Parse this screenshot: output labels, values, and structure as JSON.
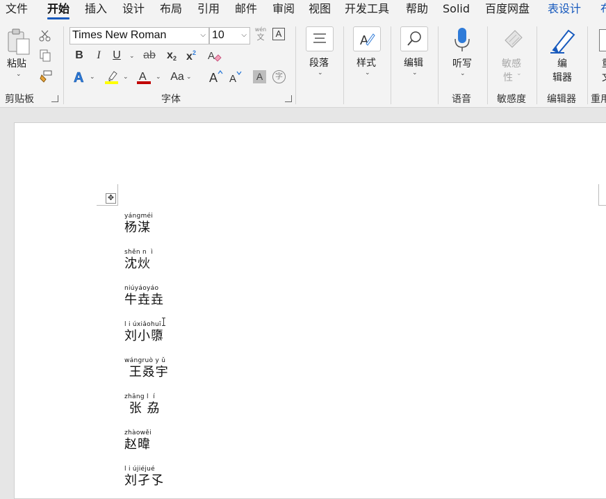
{
  "tabs": [
    {
      "label": "文件",
      "state": "normal"
    },
    {
      "label": "开始",
      "state": "active"
    },
    {
      "label": "插入",
      "state": "normal"
    },
    {
      "label": "设计",
      "state": "normal"
    },
    {
      "label": "布局",
      "state": "normal"
    },
    {
      "label": "引用",
      "state": "normal"
    },
    {
      "label": "邮件",
      "state": "normal"
    },
    {
      "label": "审阅",
      "state": "normal"
    },
    {
      "label": "视图",
      "state": "normal"
    },
    {
      "label": "开发工具",
      "state": "normal"
    },
    {
      "label": "帮助",
      "state": "normal"
    },
    {
      "label": "Solid",
      "state": "normal"
    },
    {
      "label": "百度网盘",
      "state": "normal"
    },
    {
      "label": "表设计",
      "state": "contextual"
    },
    {
      "label": "布",
      "state": "contextual"
    }
  ],
  "clipboard": {
    "paste_label": "粘贴",
    "group_label": "剪贴板"
  },
  "font": {
    "font_name": "Times New Roman",
    "font_size": "10",
    "phonetic_top": "wén",
    "phonetic_bottom": "文",
    "group_label": "字体",
    "bold": "B",
    "italic": "I",
    "underline": "U",
    "strikethrough": "ab",
    "subscript": "x",
    "superscript": "x",
    "change_case": "Aa",
    "enclose_char": "字",
    "shading_char": "A",
    "highlight_color": "#ffff00",
    "font_color": "#c00000",
    "text_effect_color": "#2f7bd8"
  },
  "paragraph": {
    "label": "段落"
  },
  "styles": {
    "label": "样式"
  },
  "editing": {
    "label": "编辑"
  },
  "voice": {
    "button_label": "听写",
    "group_label": "语音"
  },
  "sensitivity": {
    "button_line1": "敏感",
    "button_line2": "性",
    "group_label": "敏感度"
  },
  "editor": {
    "button_line1": "编",
    "button_line2": "辑器",
    "group_label": "编辑器"
  },
  "reuse": {
    "group_label": "重用",
    "button_line1": "重",
    "button_line2": "文"
  },
  "entries": [
    {
      "pinyin": "yángméi",
      "hanzi": "杨湈"
    },
    {
      "pinyin": "shěn n  ì",
      "hanzi": "沈炏"
    },
    {
      "pinyin": "niúyáoyáo",
      "hanzi": "牛垚垚"
    },
    {
      "pinyin": "l i úxiǎohuī",
      "hanzi": "刘小隳"
    },
    {
      "pinyin": "wángruò y ǔ",
      "hanzi": " 王叒宇"
    },
    {
      "pinyin": "zhāng l  í",
      "hanzi": " 张 劦"
    },
    {
      "pinyin": "zhàowěi",
      "hanzi": "赵暐"
    },
    {
      "pinyin": "l i újiéjué",
      "hanzi": "刘孑孓"
    }
  ],
  "colors": {
    "accent": "#185abd",
    "ribbon_bg": "#f3f3f3",
    "canvas_bg": "#e6e6e6"
  }
}
